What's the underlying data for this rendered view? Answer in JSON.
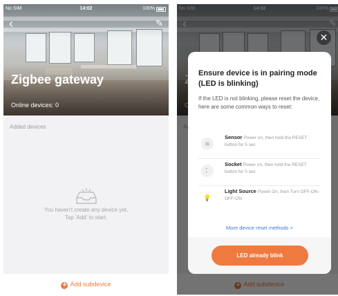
{
  "status_bar": {
    "carrier": "No SIM",
    "time": "14:02",
    "battery": "100%"
  },
  "hero": {
    "title": "Zigbee gateway",
    "online_label": "Online devices: 0"
  },
  "content": {
    "section_label": "Added devices",
    "empty_line1": "You haven't create any device yet.",
    "empty_line2": "Tap 'Add' to start."
  },
  "bottom": {
    "add_subdevice_label": "Add subdevice"
  },
  "icons": {
    "back": "chevron-left-icon",
    "edit": "pencil-icon",
    "empty": "empty-tray-icon",
    "add": "plus-circle-icon",
    "close": "close-icon"
  },
  "modal": {
    "title": "Ensure device is in pairing mode (LED is blinking)",
    "description": "If the LED is not blinking, please reset the device, here are some common ways to reset:",
    "items": [
      {
        "name": "Sensor",
        "detail": "Power on, then hold the RESET button for 5 sec",
        "icon": "sensor-icon"
      },
      {
        "name": "Socket",
        "detail": "Power on, then hold the RESET button for 5 sec",
        "icon": "socket-icon"
      },
      {
        "name": "Light Source",
        "detail": "Power On, then Turn OFF-ON-OFF-ON",
        "icon": "bulb-icon"
      }
    ],
    "more_link": "More device reset methods >",
    "confirm_button": "LED already blink"
  },
  "colors": {
    "accent": "#ef7a40",
    "link": "#3c78d8",
    "background": "#f2f2f4"
  }
}
